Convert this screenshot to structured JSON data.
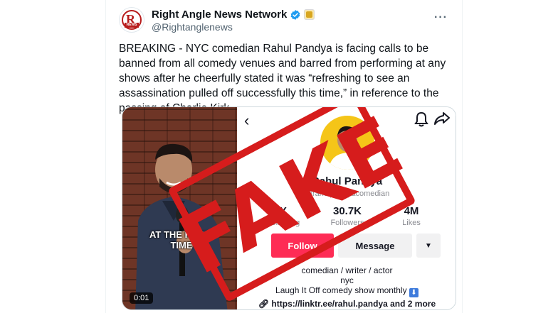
{
  "tweet": {
    "display_name": "Right Angle News Network",
    "handle": "@Rightanglenews",
    "avatar_logo": {
      "letter": "R",
      "tag": "NEWS"
    },
    "verified_color": "#1d9bf0",
    "body": "BREAKING - NYC comedian Rahul Pandya is facing calls to be banned from all comedy venues and barred from performing at any shows after he cheerfully stated it was “refreshing to see an assassination pulled off successfully this time,” in reference to the passing of Charlie Kirk."
  },
  "video": {
    "overlay_text": "AT THE RIGHT TIME",
    "timestamp": "0:01"
  },
  "profile": {
    "username": "Rahul Pandya",
    "handle": "@rahulpandyacomedian",
    "stats": [
      {
        "value": "X",
        "label": "Following"
      },
      {
        "value": "30.7K",
        "label": "Followers"
      },
      {
        "value": "4M",
        "label": "Likes"
      }
    ],
    "follow_label": "Follow",
    "message_label": "Message",
    "bio_line1": "comedian / writer / actor",
    "bio_line2": "nyc",
    "bio_line3": "Laugh It Off comedy show monthly",
    "link": "https://linktr.ee/rahul.pandya  and 2 more"
  },
  "stamp": {
    "text": "FAKE",
    "color": "#d61c1c"
  },
  "colors": {
    "accent": "#fe2c55",
    "text": "#0f1419",
    "muted": "#536471"
  }
}
